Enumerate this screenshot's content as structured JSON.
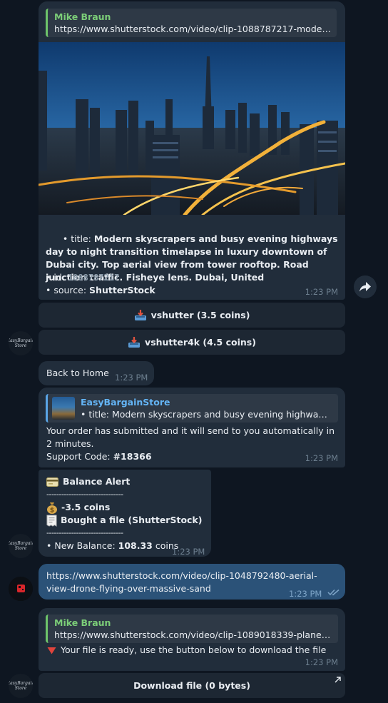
{
  "messages": {
    "m1": {
      "reply_name": "Mike Braun",
      "reply_text": "https://www.shutterstock.com/video/clip-1088787217-modern-s...",
      "title_prefix": "• title: ",
      "title": "Modern skyscrapers and busy evening highways day to night transition timelapse in luxury downtown of Dubai city. Top aerial view from tower rooftop. Road junction traffic. Fisheye lens. Dubai, United",
      "id_prefix": "• id: ",
      "id": "1088787217",
      "source_prefix": "• source: ",
      "source": "ShutterStock",
      "time": "1:23 PM",
      "buttons": [
        "vshutter (3.5 coins)",
        "vshutter4k (4.5 coins)"
      ]
    },
    "m2": {
      "text": "Back to Home",
      "time": "1:23 PM"
    },
    "m3": {
      "reply_name": "EasyBargainStore",
      "reply_text": "• title: Modern skyscrapers and busy evening highways ...",
      "text": "Your order has submitted and it will send to you automatically in 2 minutes.",
      "support_prefix": "Support Code: ",
      "support_code": "#18366",
      "time": "1:23 PM"
    },
    "m4": {
      "title": "Balance Alert",
      "divider": "-------------------------------",
      "amount": "-3.5 coins",
      "action": "Bought a file (ShutterStock)",
      "divider2": "-------------------------------",
      "balance_prefix": "• New Balance: ",
      "balance": "108.33",
      "balance_suffix": " coins",
      "time": "1:23 PM"
    },
    "m5": {
      "text": "https://www.shutterstock.com/video/clip-1048792480-aerial-view-drone-flying-over-massive-sand",
      "time": "1:23 PM"
    },
    "m6": {
      "reply_name": "Mike Braun",
      "reply_text": "https://www.shutterstock.com/video/clip-1089018339-planet-ea...",
      "text": "Your file is ready, use the button below to download the file",
      "time": "1:23 PM",
      "button": "Download file (0 bytes)"
    }
  },
  "avatars": {
    "store": "EasyBargain Store"
  },
  "icons": {
    "inbox": "inbox-tray-icon",
    "card": "credit-card-icon",
    "money": "money-bag-icon",
    "receipt": "receipt-icon",
    "red_triangle": "red-triangle-down-icon",
    "forward": "forward-icon",
    "read": "double-check-icon",
    "link": "arrow-up-right-icon"
  },
  "colors": {
    "background": "#0e1621",
    "incoming": "#212d3b",
    "outgoing": "#2b5278",
    "reply_name_green": "#7cce78",
    "reply_name_blue": "#64b5f6"
  }
}
